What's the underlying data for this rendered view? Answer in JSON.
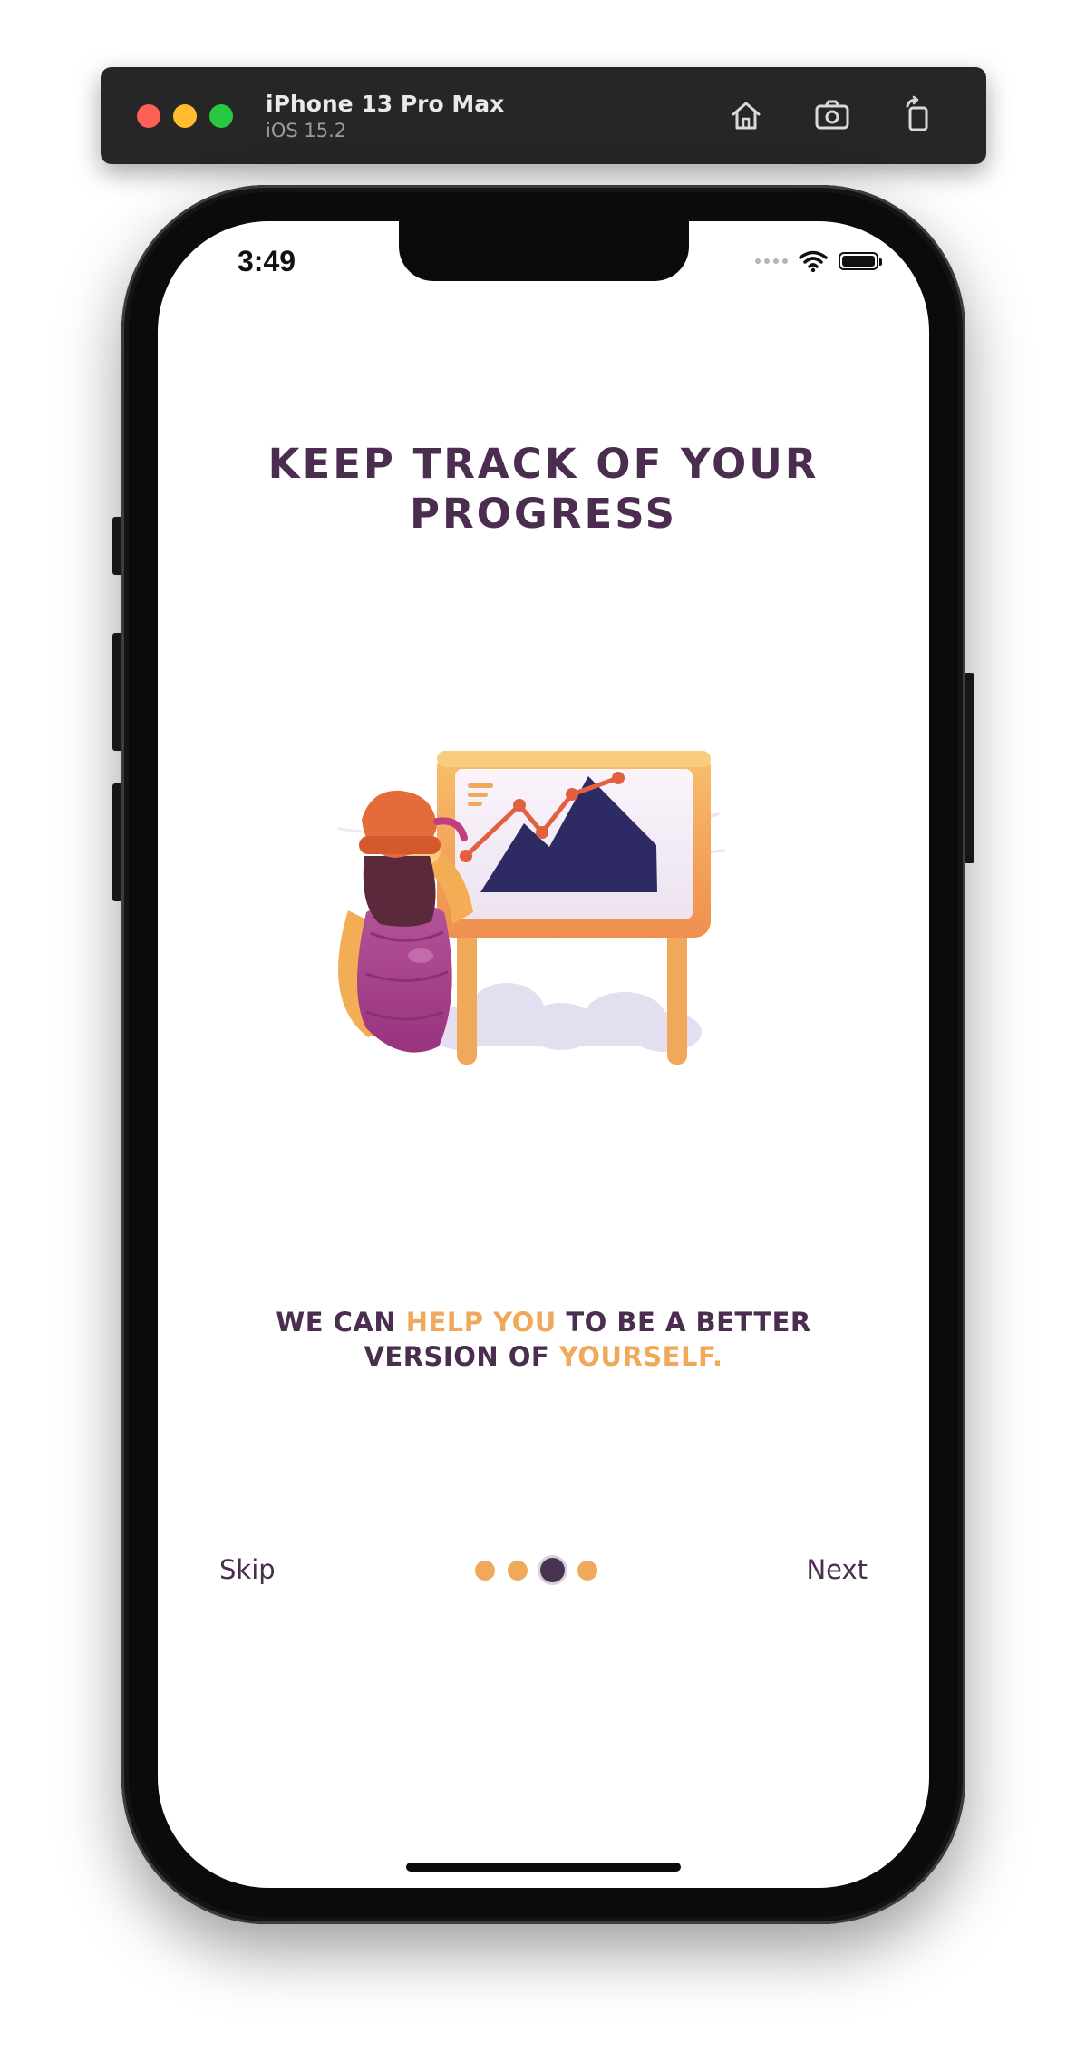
{
  "simulator": {
    "device_name": "iPhone 13 Pro Max",
    "os_version": "iOS 15.2",
    "toolbar_icons": [
      "home-icon",
      "screenshot-icon",
      "rotate-icon"
    ]
  },
  "status_bar": {
    "time": "3:49",
    "icons": [
      "cellular-signal-icon",
      "wifi-icon",
      "battery-icon"
    ]
  },
  "onboarding": {
    "title": "KEEP TRACK OF YOUR PROGRESS",
    "illustration": "person-pointing-at-growth-chart-board",
    "tagline": {
      "part1": "WE CAN ",
      "highlight1": "HELP YOU",
      "part2": " TO BE A BETTER VERSION OF ",
      "highlight2": "YOURSELF."
    },
    "skip_label": "Skip",
    "next_label": "Next",
    "page_indicator": {
      "total": 4,
      "current": 3
    }
  },
  "colors": {
    "primary_text": "#4a2d4f",
    "accent": "#f0a95b",
    "active_dot": "#4a3350"
  }
}
